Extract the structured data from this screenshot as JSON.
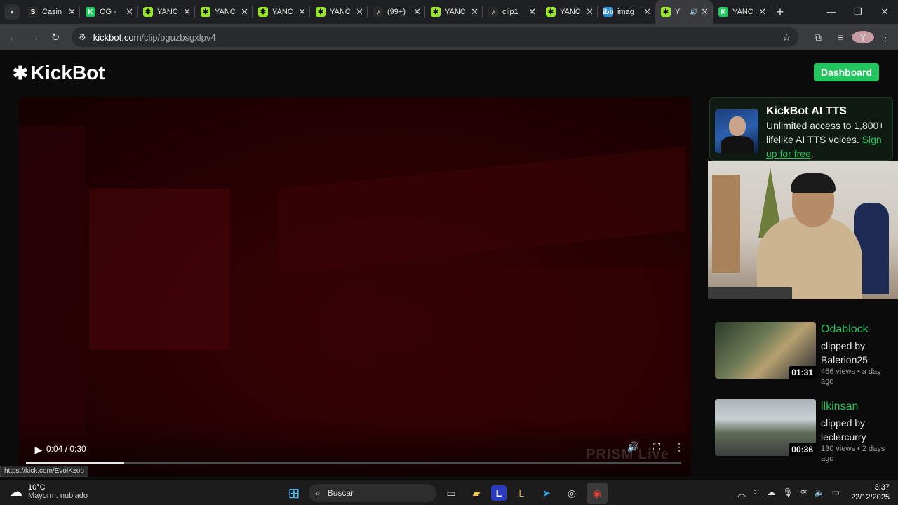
{
  "browser": {
    "tabs": [
      {
        "title": "Casin",
        "favicon": "S",
        "favicon_color": "#2a2a2a",
        "active": false
      },
      {
        "title": "OG -",
        "favicon": "K",
        "favicon_color": "#22c55e",
        "active": false
      },
      {
        "title": "YANC",
        "favicon": "✱",
        "favicon_color": "#9ae62a",
        "active": false
      },
      {
        "title": "YANC",
        "favicon": "✱",
        "favicon_color": "#9ae62a",
        "active": false
      },
      {
        "title": "YANC",
        "favicon": "✱",
        "favicon_color": "#9ae62a",
        "active": false
      },
      {
        "title": "YANC",
        "favicon": "✱",
        "favicon_color": "#9ae62a",
        "active": false
      },
      {
        "title": "(99+)",
        "favicon": "♪",
        "favicon_color": "#2a2a2a",
        "active": false
      },
      {
        "title": "YANC",
        "favicon": "✱",
        "favicon_color": "#9ae62a",
        "active": false
      },
      {
        "title": "clip1",
        "favicon": "♪",
        "favicon_color": "#2a2a2a",
        "active": false
      },
      {
        "title": "YANC",
        "favicon": "✱",
        "favicon_color": "#9ae62a",
        "active": false
      },
      {
        "title": "imag",
        "favicon": "ibb",
        "favicon_color": "#2f8fd6",
        "active": false
      },
      {
        "title": "Y",
        "favicon": "✱",
        "favicon_color": "#9ae62a",
        "active": true
      },
      {
        "title": "YANC",
        "favicon": "K",
        "favicon_color": "#22c55e",
        "active": false
      }
    ],
    "url_host": "kickbot.com",
    "url_path": "/clip/bguzbsgxlpv4",
    "profile_initial": "Y",
    "status_url": "https://kick.com/EvolKzoo"
  },
  "site": {
    "logo_text": "KickBot",
    "dashboard_label": "Dashboard",
    "accent": "#22c55e"
  },
  "player": {
    "time": "0:04 / 0:30",
    "progress": 0.15,
    "watermark": "PRISM Live"
  },
  "ad": {
    "title": "KickBot AI TTS",
    "text": "Unlimited access to 1,800+ lifelike AI TTS voices. ",
    "link": "Sign up for free",
    "text_end": "."
  },
  "clips": [
    {
      "channel": "Odablock",
      "clipped_by": "clipped by Balerion25",
      "meta": "466 views • a day ago",
      "duration": "01:31"
    },
    {
      "channel": "ilkinsan",
      "clipped_by": "clipped by leclercurry",
      "meta": "130 views • 2 days ago",
      "duration": "00:36"
    }
  ],
  "taskbar": {
    "temp": "10°C",
    "weather": "Mayorm. nublado",
    "search_placeholder": "Buscar",
    "time": "3:37",
    "date": "22/12/2025"
  }
}
